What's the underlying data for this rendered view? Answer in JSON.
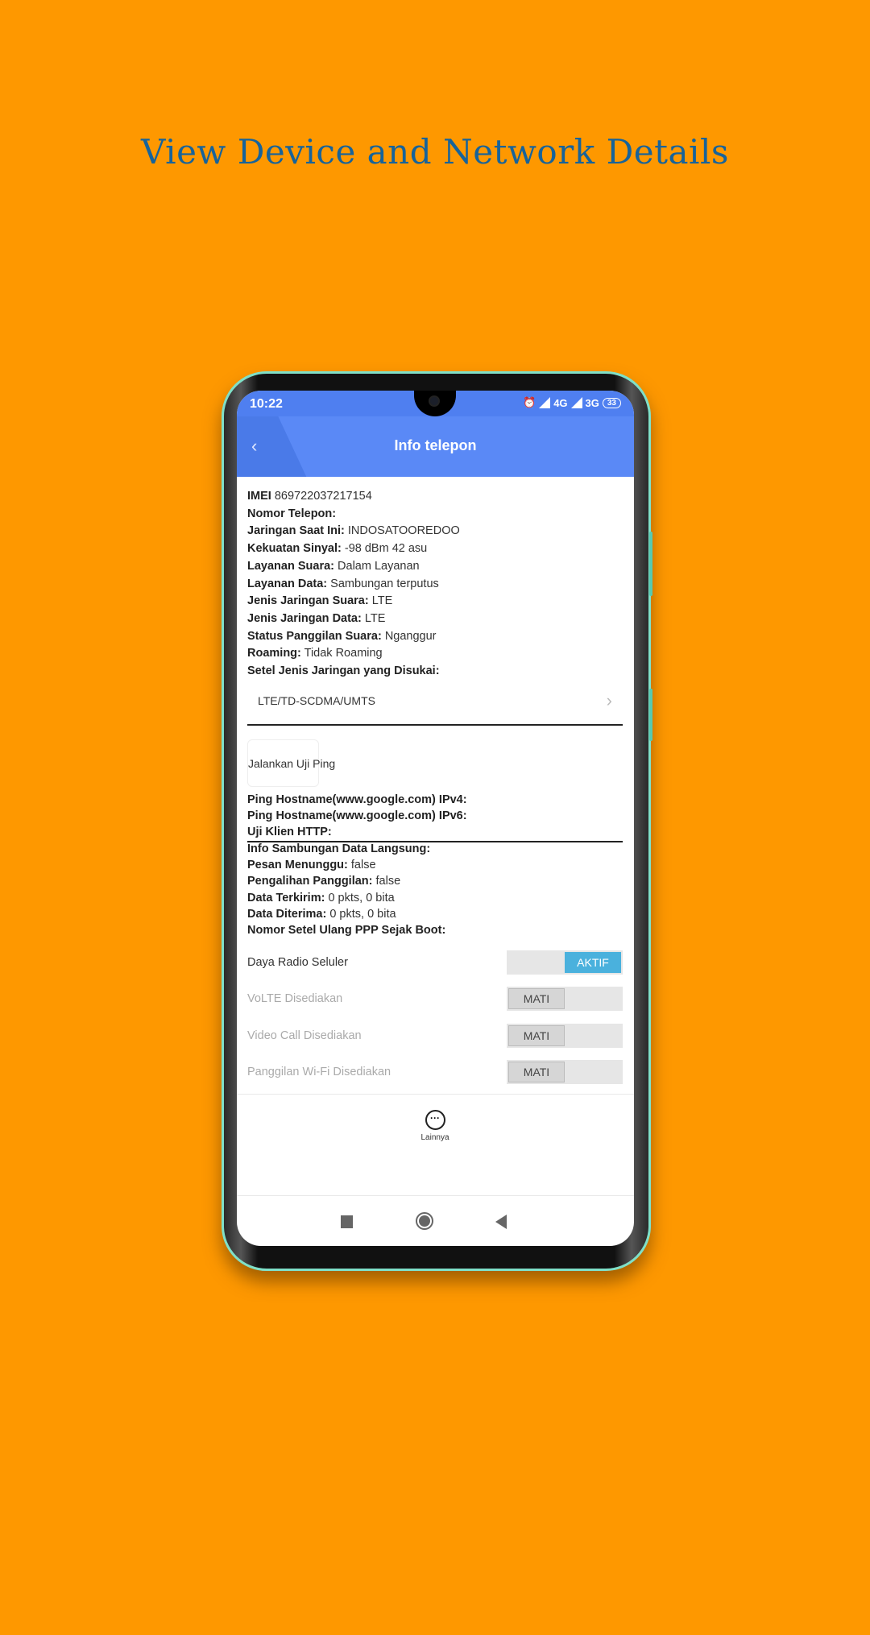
{
  "promo_title": "View Device and Network Details",
  "status_bar": {
    "time": "10:22",
    "network1": "4G",
    "network2": "3G",
    "battery": "33"
  },
  "header": {
    "title": "Info telepon"
  },
  "info": [
    {
      "label": "IMEI",
      "value": "869722037217154"
    },
    {
      "label": "Nomor Telepon:",
      "value": ""
    },
    {
      "label": "Jaringan Saat Ini:",
      "value": "INDOSATOOREDOO"
    },
    {
      "label": "Kekuatan Sinyal:",
      "value": "-98 dBm   42 asu"
    },
    {
      "label": "Layanan Suara:",
      "value": "Dalam Layanan"
    },
    {
      "label": "Layanan Data:",
      "value": "Sambungan terputus"
    },
    {
      "label": "Jenis Jaringan Suara:",
      "value": "LTE"
    },
    {
      "label": "Jenis Jaringan Data:",
      "value": "LTE"
    },
    {
      "label": "Status Panggilan Suara:",
      "value": "Nganggur"
    },
    {
      "label": "Roaming:",
      "value": "Tidak Roaming"
    },
    {
      "label": "Setel Jenis Jaringan yang Disukai:",
      "value": ""
    }
  ],
  "preferred_network": "LTE/TD-SCDMA/UMTS",
  "ping_button": "Jalankan Uji Ping",
  "ping_info": [
    {
      "label": "Ping Hostname(www.google.com) IPv4:",
      "value": ""
    },
    {
      "label": "Ping Hostname(www.google.com) IPv6:",
      "value": ""
    },
    {
      "label": "Uji Klien HTTP:",
      "value": ""
    }
  ],
  "data_info": [
    {
      "label": "Info Sambungan Data Langsung:",
      "value": ""
    },
    {
      "label": "Pesan Menunggu:",
      "value": "false"
    },
    {
      "label": "Pengalihan Panggilan:",
      "value": "false"
    },
    {
      "label": "Data Terkirim:",
      "value": "0 pkts, 0 bita"
    },
    {
      "label": "Data Diterima:",
      "value": "0 pkts, 0 bita"
    },
    {
      "label": "Nomor Setel Ulang PPP Sejak Boot:",
      "value": ""
    }
  ],
  "toggles": [
    {
      "label": "Daya Radio Seluler",
      "state": "AKTIF",
      "on": true,
      "enabled": true
    },
    {
      "label": "VoLTE Disediakan",
      "state": "MATI",
      "on": false,
      "enabled": false
    },
    {
      "label": "Video Call Disediakan",
      "state": "MATI",
      "on": false,
      "enabled": false
    },
    {
      "label": "Panggilan Wi-Fi Disediakan",
      "state": "MATI",
      "on": false,
      "enabled": false
    }
  ],
  "more": {
    "label": "Lainnya",
    "icon": "more-horizontal-icon"
  },
  "colors": {
    "background": "#fe9800",
    "header": "#5a89f6",
    "toggle_on": "#4ab1dd",
    "title": "#17639a"
  }
}
